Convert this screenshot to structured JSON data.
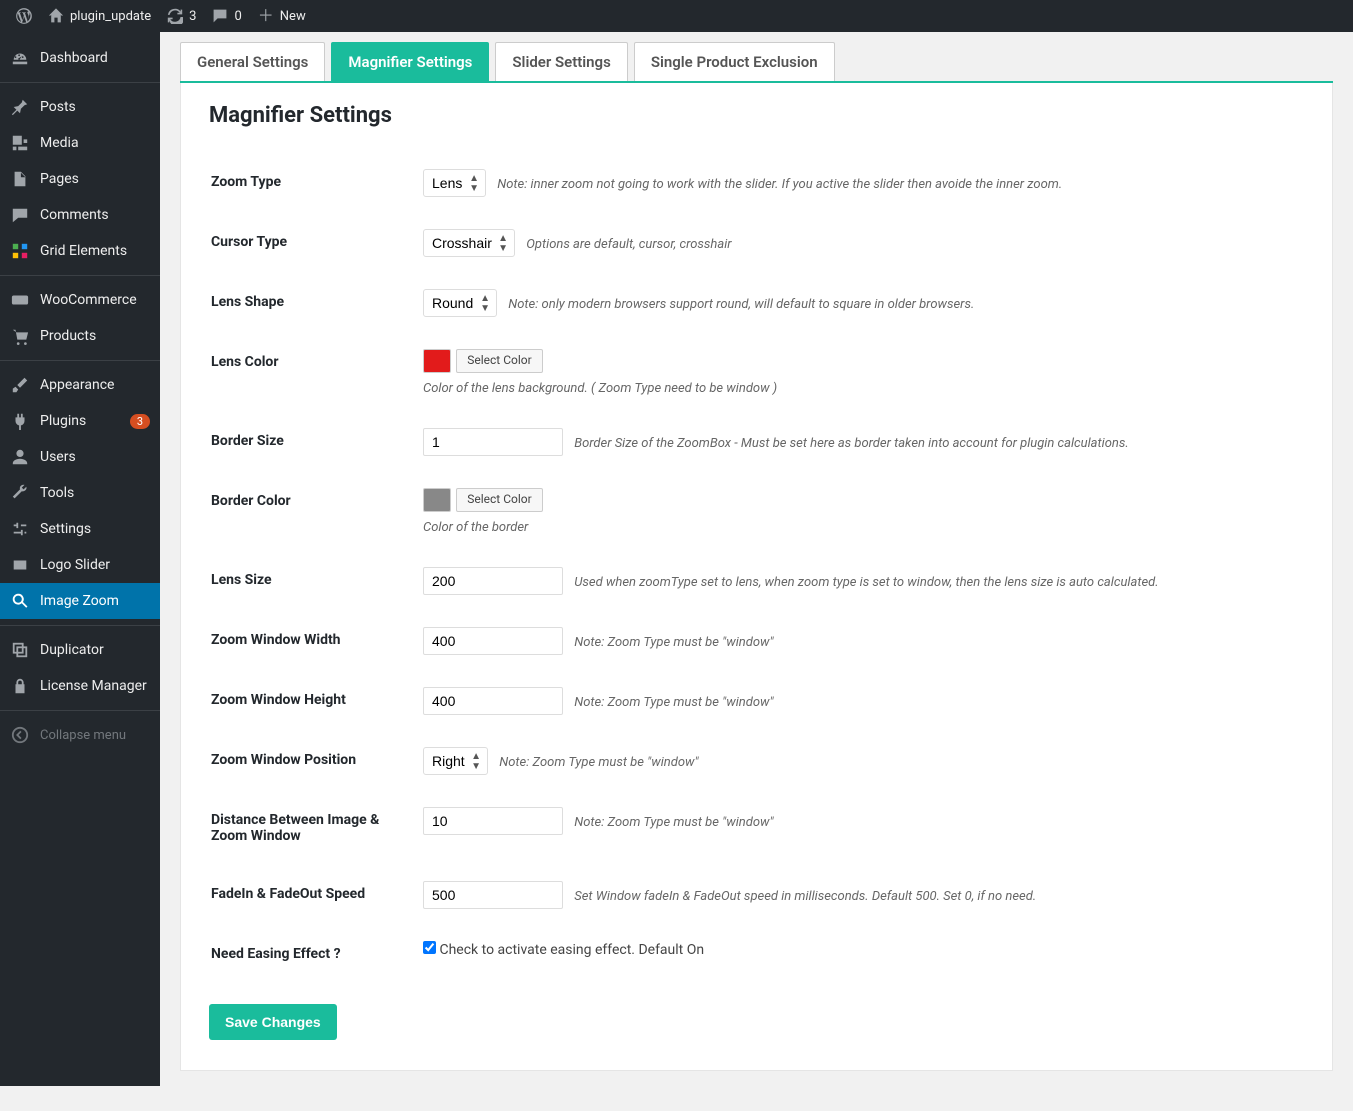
{
  "adminbar": {
    "site_name": "plugin_update",
    "updates_count": "3",
    "comments_count": "0",
    "new_label": "New"
  },
  "sidebar": {
    "items": [
      {
        "label": "Dashboard"
      },
      {
        "label": "Posts"
      },
      {
        "label": "Media"
      },
      {
        "label": "Pages"
      },
      {
        "label": "Comments"
      },
      {
        "label": "Grid Elements"
      },
      {
        "label": "WooCommerce"
      },
      {
        "label": "Products"
      },
      {
        "label": "Appearance"
      },
      {
        "label": "Plugins",
        "badge": "3"
      },
      {
        "label": "Users"
      },
      {
        "label": "Tools"
      },
      {
        "label": "Settings"
      },
      {
        "label": "Logo Slider"
      },
      {
        "label": "Image Zoom"
      },
      {
        "label": "Duplicator"
      },
      {
        "label": "License Manager"
      }
    ],
    "collapse_label": "Collapse menu"
  },
  "tabs": [
    {
      "label": "General Settings"
    },
    {
      "label": "Magnifier Settings"
    },
    {
      "label": "Slider Settings"
    },
    {
      "label": "Single Product Exclusion"
    }
  ],
  "page": {
    "title": "Magnifier Settings",
    "save_label": "Save Changes"
  },
  "fields": {
    "zoom_type": {
      "label": "Zoom Type",
      "value": "Lens",
      "note": "Note: inner zoom not going to work with the slider. If you active the slider then avoide the inner zoom."
    },
    "cursor_type": {
      "label": "Cursor Type",
      "value": "Crosshair",
      "note": "Options are default, cursor, crosshair"
    },
    "lens_shape": {
      "label": "Lens Shape",
      "value": "Round",
      "note": "Note: only modern browsers support round, will default to square in older browsers."
    },
    "lens_color": {
      "label": "Lens Color",
      "swatch": "#e21b1b",
      "button": "Select Color",
      "note": "Color of the lens background. ( Zoom Type need to be window )"
    },
    "border_size": {
      "label": "Border Size",
      "value": "1",
      "note": "Border Size of the ZoomBox - Must be set here as border taken into account for plugin calculations."
    },
    "border_color": {
      "label": "Border Color",
      "swatch": "#888888",
      "button": "Select Color",
      "note": "Color of the border"
    },
    "lens_size": {
      "label": "Lens Size",
      "value": "200",
      "note": "Used when zoomType set to lens, when zoom type is set to window, then the lens size is auto calculated."
    },
    "zoom_window_width": {
      "label": "Zoom Window Width",
      "value": "400",
      "note": "Note: Zoom Type must be \"window\""
    },
    "zoom_window_height": {
      "label": "Zoom Window Height",
      "value": "400",
      "note": "Note: Zoom Type must be \"window\""
    },
    "zoom_window_position": {
      "label": "Zoom Window Position",
      "value": "Right",
      "note": "Note: Zoom Type must be \"window\""
    },
    "distance": {
      "label": "Distance Between Image & Zoom Window",
      "value": "10",
      "note": "Note: Zoom Type must be \"window\""
    },
    "fade_speed": {
      "label": "FadeIn & FadeOut Speed",
      "value": "500",
      "note": "Set Window fadeIn & FadeOut speed in milliseconds. Default 500. Set 0, if no need."
    },
    "easing": {
      "label": "Need Easing Effect ?",
      "checkbox_label": "Check to activate easing effect. Default On"
    }
  }
}
